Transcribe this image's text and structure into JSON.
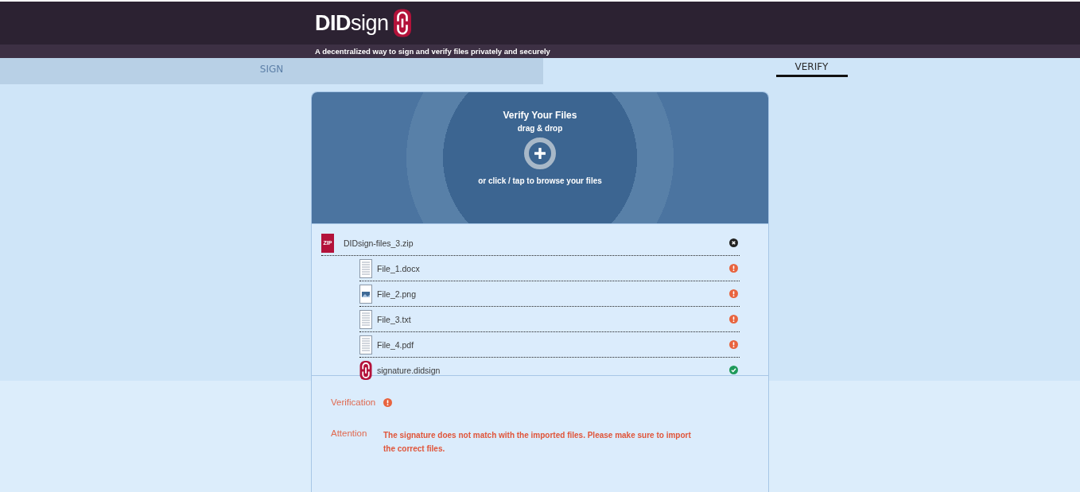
{
  "header": {
    "logo_bold": "DID",
    "logo_light": "sign",
    "tagline": "A decentralized way to sign and verify files privately and securely"
  },
  "tabs": [
    {
      "label": "SIGN",
      "selected": false
    },
    {
      "label": "VERIFY",
      "selected": true
    }
  ],
  "dropzone": {
    "title": "Verify Your Files",
    "subtitle": "drag & drop",
    "hint": "or click / tap to browse your files"
  },
  "archive": {
    "badge": "ZIP",
    "name": "DIDsign-files_3.zip"
  },
  "files": [
    {
      "name": "File_1.docx",
      "kind": "document",
      "verified": false
    },
    {
      "name": "File_2.png",
      "kind": "image",
      "verified": false
    },
    {
      "name": "File_3.txt",
      "kind": "document",
      "verified": false
    },
    {
      "name": "File_4.pdf",
      "kind": "document",
      "verified": false
    },
    {
      "name": "signature.didsign",
      "kind": "signature",
      "verified": true
    }
  ],
  "result": {
    "label": "Verification",
    "verified": false,
    "attention_label": "Attention",
    "message": "The signature does not match with the imported files. Please make sure to import the correct files."
  }
}
